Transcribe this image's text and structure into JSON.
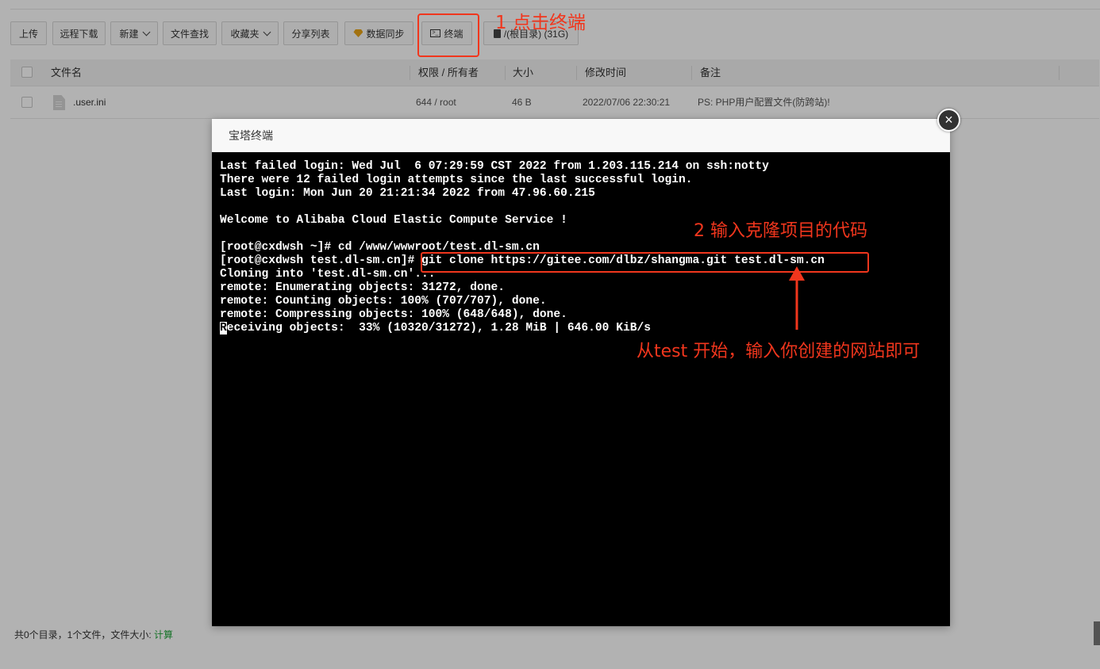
{
  "toolbar": {
    "upload": "上传",
    "remote_download": "远程下载",
    "new": "新建",
    "file_search": "文件查找",
    "favorites": "收藏夹",
    "share_list": "分享列表",
    "data_sync": "数据同步",
    "terminal": "终端",
    "disk": "/(根目录) (31G)"
  },
  "table": {
    "headers": [
      "文件名",
      "权限 / 所有者",
      "大小",
      "修改时间",
      "备注"
    ],
    "rows": [
      {
        "name": ".user.ini",
        "perm": "644 / root",
        "size": "46 B",
        "mtime": "2022/07/06 22:30:21",
        "note": "PS: PHP用户配置文件(防跨站)!"
      }
    ]
  },
  "modal": {
    "title": "宝塔终端",
    "close": "×"
  },
  "terminal": {
    "lines": [
      "Last failed login: Wed Jul  6 07:29:59 CST 2022 from 1.203.115.214 on ssh:notty",
      "There were 12 failed login attempts since the last successful login.",
      "Last login: Mon Jun 20 21:21:34 2022 from 47.96.60.215",
      "",
      "Welcome to Alibaba Cloud Elastic Compute Service !",
      "",
      "[root@cxdwsh ~]# cd /www/wwwroot/test.dl-sm.cn",
      "[root@cxdwsh test.dl-sm.cn]# git clone https://gitee.com/dlbz/shangma.git test.dl-sm.cn",
      "Cloning into 'test.dl-sm.cn'...",
      "remote: Enumerating objects: 31272, done.",
      "remote: Counting objects: 100% (707/707), done.",
      "remote: Compressing objects: 100% (648/648), done."
    ],
    "last_line_cursor": "R",
    "last_line_rest": "eceiving objects:  33% (10320/31272), 1.28 MiB | 646.00 KiB/s"
  },
  "footer": {
    "summary": "共0个目录，1个文件，文件大小: ",
    "calc": "计算"
  },
  "annotations": {
    "step1": "1   点击终端",
    "step2": "2  输入克隆项目的代码",
    "note": "从test 开始，输入你创建的网站即可",
    "color": "#f1361d"
  }
}
